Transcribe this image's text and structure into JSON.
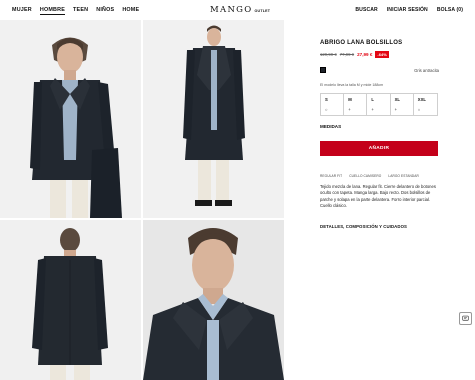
{
  "header": {
    "nav": [
      "MUJER",
      "HOMBRE",
      "TEEN",
      "NIÑOS",
      "HOME"
    ],
    "active_nav": "HOMBRE",
    "logo_brand": "MANGO",
    "logo_suffix": "OUTLET",
    "right_nav": [
      "BUSCAR",
      "INICIAR SESIÓN",
      "BOLSA (0)"
    ]
  },
  "product": {
    "title": "ABRIGO LANA BOLSILLOS",
    "old_price_1": "129,99 €",
    "old_price_2": "77,99 €",
    "price": "27,99 €",
    "discount": "-64%",
    "color_name": "Gris antracita",
    "swatch_color": "#1e2229",
    "model_note": "El modelo lleva la talla M y mide 188cm",
    "sizes": [
      {
        "label": "S",
        "mark": "○"
      },
      {
        "label": "M",
        "mark": "+"
      },
      {
        "label": "L",
        "mark": "+"
      },
      {
        "label": "XL",
        "mark": "+"
      },
      {
        "label": "XXL",
        "mark": "○"
      }
    ],
    "measurements_label": "MEDIDAS",
    "add_button": "AÑADIR",
    "features": [
      "REGULAR FIT",
      "CUELLO CAMISERO",
      "LARGO ESTANDAR"
    ],
    "description": "Tejido mezcla de lana. Regular fit. Cierre delantero de botones oculto con tapeta. Manga larga. Bajo recto. Dos bolsillos de parche y solapa en la parte delantera. Forro interior parcial. Cuello clásico.",
    "details_label": "DETALLES, COMPOSICIÓN Y CUIDADOS",
    "accent_color": "#e30613"
  },
  "icons": {
    "chat": "chat-icon"
  }
}
